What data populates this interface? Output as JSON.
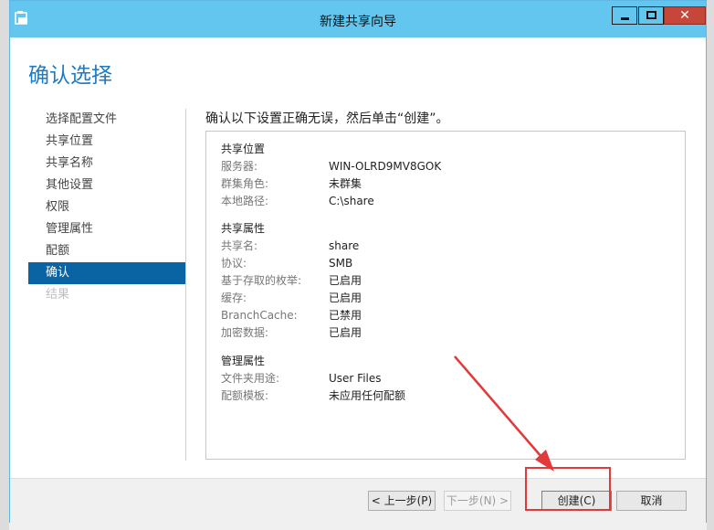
{
  "window": {
    "title": "新建共享向导",
    "close_glyph": "✕"
  },
  "page": {
    "title": "确认选择",
    "heading": "确认以下设置正确无误，然后单击“创建”。"
  },
  "nav": {
    "items": [
      {
        "label": "选择配置文件",
        "state": "normal"
      },
      {
        "label": "共享位置",
        "state": "normal"
      },
      {
        "label": "共享名称",
        "state": "normal"
      },
      {
        "label": "其他设置",
        "state": "normal"
      },
      {
        "label": "权限",
        "state": "normal"
      },
      {
        "label": "管理属性",
        "state": "normal"
      },
      {
        "label": "配额",
        "state": "normal"
      },
      {
        "label": "确认",
        "state": "active"
      },
      {
        "label": "结果",
        "state": "disabled"
      }
    ]
  },
  "summary": {
    "share_location": {
      "title": "共享位置",
      "rows": [
        {
          "key": "服务器:",
          "value": "WIN-OLRD9MV8GOK"
        },
        {
          "key": "群集角色:",
          "value": "未群集"
        },
        {
          "key": "本地路径:",
          "value": "C:\\share"
        }
      ]
    },
    "share_properties": {
      "title": "共享属性",
      "rows": [
        {
          "key": "共享名:",
          "value": "share"
        },
        {
          "key": "协议:",
          "value": "SMB"
        },
        {
          "key": "基于存取的枚举:",
          "value": "已启用"
        },
        {
          "key": "缓存:",
          "value": "已启用"
        },
        {
          "key": "BranchCache:",
          "value": "已禁用"
        },
        {
          "key": "加密数据:",
          "value": "已启用"
        }
      ]
    },
    "management_properties": {
      "title": "管理属性",
      "rows": [
        {
          "key": "文件夹用途:",
          "value": "User Files"
        },
        {
          "key": "配额模板:",
          "value": "未应用任何配额"
        }
      ]
    }
  },
  "footer": {
    "prev_label": "< 上一步(P)",
    "next_label": "下一步(N) >",
    "create_label": "创建(C)",
    "cancel_label": "取消"
  },
  "colors": {
    "titlebar": "#63c6ee",
    "accent": "#1d7ac4",
    "nav_active": "#0a64a4",
    "annotation": "#e23a3a"
  }
}
